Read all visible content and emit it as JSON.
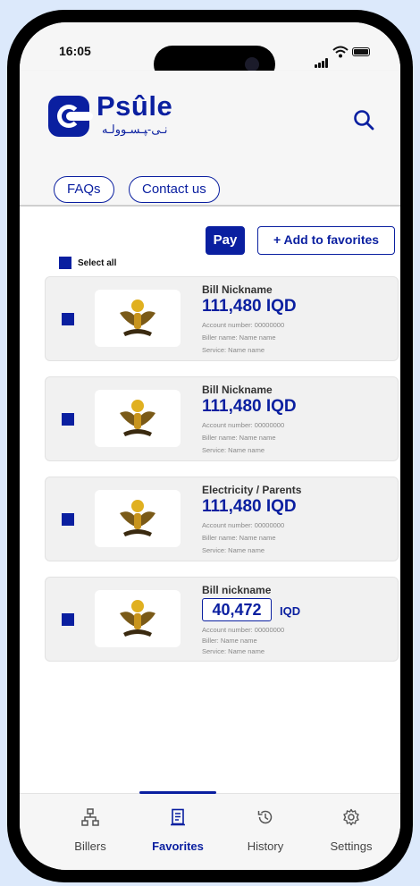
{
  "status": {
    "time": "16:05"
  },
  "header": {
    "logo_text": "Psûle",
    "logo_subtext": "ﻧـﻰ-ﭙـﺴـﻮوﻟـﻪ",
    "faq_label": "FAQs",
    "contact_label": "Contact us"
  },
  "actions": {
    "pay_label": "Pay",
    "add_fav_label": "+ Add to favorites",
    "select_all_label": "Select all"
  },
  "bills": [
    {
      "nickname": "Bill Nickname",
      "amount": "111,480 IQD",
      "account": "Account number: 00000000",
      "biller": "Biller name: Name name",
      "service": "Service: Name name"
    },
    {
      "nickname": "Bill Nickname",
      "amount": "111,480 IQD",
      "account": "Account number: 00000000",
      "biller": "Biller name: Name name",
      "service": "Service: Name name"
    },
    {
      "nickname": "Electricity / Parents",
      "amount": "111,480 IQD",
      "account": "Account number: 00000000",
      "biller": "Biller name: Name name",
      "service": "Service: Name name"
    },
    {
      "nickname": "Bill nickname",
      "amount_value": "40,472",
      "currency": "IQD",
      "account": "Account number: 00000000",
      "biller": "Biller: Name name",
      "service": "Service: Name name"
    }
  ],
  "tabs": [
    {
      "label": "Billers",
      "icon": "network-icon"
    },
    {
      "label": "Favorites",
      "icon": "receipt-icon",
      "active": true
    },
    {
      "label": "History",
      "icon": "history-icon"
    },
    {
      "label": "Settings",
      "icon": "gear-icon"
    }
  ],
  "colors": {
    "brand": "#0a1fa0",
    "background": "#dce9fb"
  }
}
